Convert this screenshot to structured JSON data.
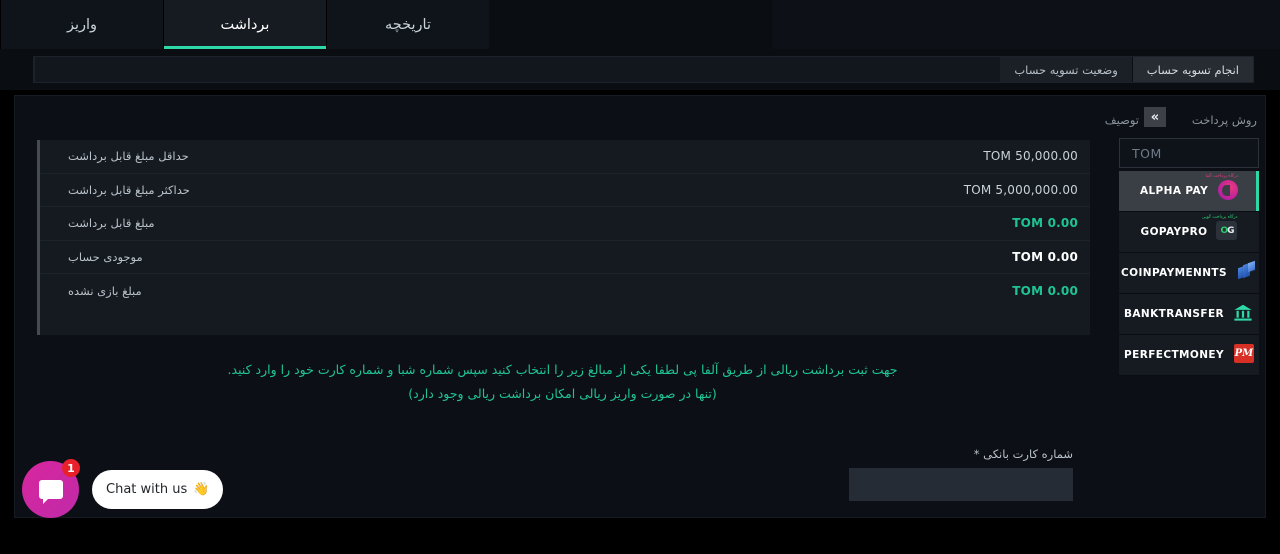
{
  "tabs": [
    {
      "label": "واریز",
      "active": false,
      "name": "tab-deposit"
    },
    {
      "label": "برداشت",
      "active": true,
      "name": "tab-withdraw"
    },
    {
      "label": "تاریخچه",
      "active": false,
      "name": "tab-history"
    }
  ],
  "subtabs": [
    {
      "label": "انجام تسویه حساب",
      "active": true,
      "name": "subtab-do-settlement"
    },
    {
      "label": "وضعیت تسویه حساب",
      "active": false,
      "name": "subtab-settlement-status"
    }
  ],
  "rail": {
    "heading": "روش پرداخت",
    "description": "توصیف",
    "chevron": "»",
    "currency_value": "TOM",
    "methods": [
      {
        "name": "ALPHA PAY",
        "sub": "درگاه پرداخت آلفا",
        "selected": true,
        "logo": "alphapay-logo"
      },
      {
        "name": "GOPAYPRO",
        "sub": "درگاه پرداخت گوپی",
        "selected": false,
        "logo": "gopaypro-logo"
      },
      {
        "name": "COINPAYMENNTS",
        "sub": "",
        "selected": false,
        "logo": "coinpayments-logo"
      },
      {
        "name": "BANKTRANSFER",
        "sub": "",
        "selected": false,
        "logo": "banktransfer-logo"
      },
      {
        "name": "PERFECTMONEY",
        "sub": "",
        "selected": false,
        "logo": "perfectmoney-logo"
      }
    ]
  },
  "info_rows": [
    {
      "label": "حداقل مبلغ قابل برداشت",
      "value": "TOM 50,000.00",
      "style": "gray"
    },
    {
      "label": "حداکثر مبلغ قابل برداشت",
      "value": "TOM 5,000,000.00",
      "style": "gray"
    },
    {
      "label": "مبلغ قابل برداشت",
      "value": "TOM 0.00",
      "style": "green"
    },
    {
      "label": "موجودی حساب",
      "value": "TOM 0.00",
      "style": "white"
    },
    {
      "label": "مبلغ بازی نشده",
      "value": "TOM 0.00",
      "style": "green"
    }
  ],
  "notice": {
    "line1": "جهت ثبت برداشت ریالی از طریق آلفا پی لطفا یکی از مبالغ زیر را انتخاب کنید سپس شماره شبا و شماره کارت خود را وارد کنید.",
    "line2": "(تنها در صورت واریز ریالی امکان برداشت ریالی وجود دارد)"
  },
  "card_field": {
    "label": "شماره کارت بانکی *",
    "value": "",
    "placeholder": ""
  },
  "chat": {
    "badge": "1",
    "label": "Chat with us",
    "emoji": "👋"
  },
  "colors": {
    "accent_green": "#2fd8a8",
    "value_green": "#1fc494",
    "chat_pink": "#d8269e",
    "badge_red": "#e8202a",
    "background": "#0c1016"
  }
}
